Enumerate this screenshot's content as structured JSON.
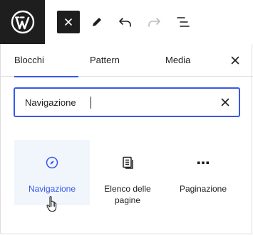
{
  "toolbar": {
    "logo_icon": "wordpress-logo-icon",
    "close_icon": "close-icon",
    "tools_icon": "pencil-icon",
    "undo_icon": "undo-icon",
    "redo_icon": "redo-icon",
    "outline_icon": "list-view-icon"
  },
  "inserter": {
    "tabs": [
      {
        "label": "Blocchi",
        "selected": true
      },
      {
        "label": "Pattern",
        "selected": false
      },
      {
        "label": "Media",
        "selected": false
      }
    ],
    "close_icon": "close-icon",
    "search": {
      "value": "Navigazione",
      "clear_icon": "clear-search-icon"
    },
    "results": [
      {
        "label": "Navigazione",
        "icon": "compass-icon",
        "highlighted": true
      },
      {
        "label": "Elenco delle pagine",
        "icon": "page-list-icon",
        "highlighted": false
      },
      {
        "label": "Paginazione",
        "icon": "more-dots-icon",
        "highlighted": false
      }
    ]
  },
  "colors": {
    "accent": "#3858e9",
    "dark": "#1e1e1e",
    "highlight_bg": "#f0f6fc"
  }
}
